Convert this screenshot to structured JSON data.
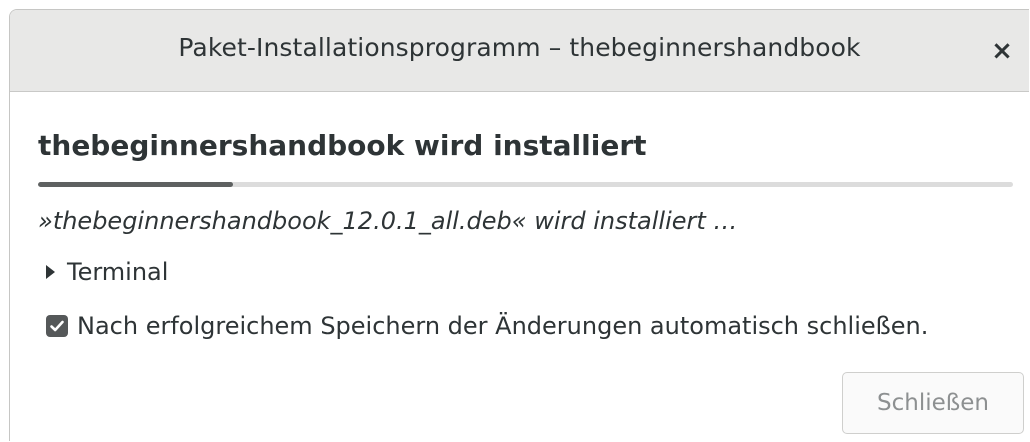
{
  "window": {
    "title": "Paket-Installationsprogramm – thebeginnershandbook",
    "close_icon": "×"
  },
  "main": {
    "heading": "thebeginnershandbook wird installiert",
    "progress_fraction": 0.2,
    "status": "»thebeginnershandbook_12.0.1_all.deb« wird installiert …",
    "expander_label": "Terminal",
    "expander_expanded": false,
    "auto_close_label": "Nach erfolgreichem Speichern der Änderungen automatisch schließen.",
    "auto_close_checked": true
  },
  "footer": {
    "close_button_label": "Schließen",
    "close_button_enabled": false
  },
  "colors": {
    "titlebar": "#e8e8e7",
    "text": "#2e3436",
    "progress_fill": "#5e6161",
    "progress_track": "#dcdcdc",
    "checkbox": "#555859",
    "disabled_text": "#8d9091"
  }
}
